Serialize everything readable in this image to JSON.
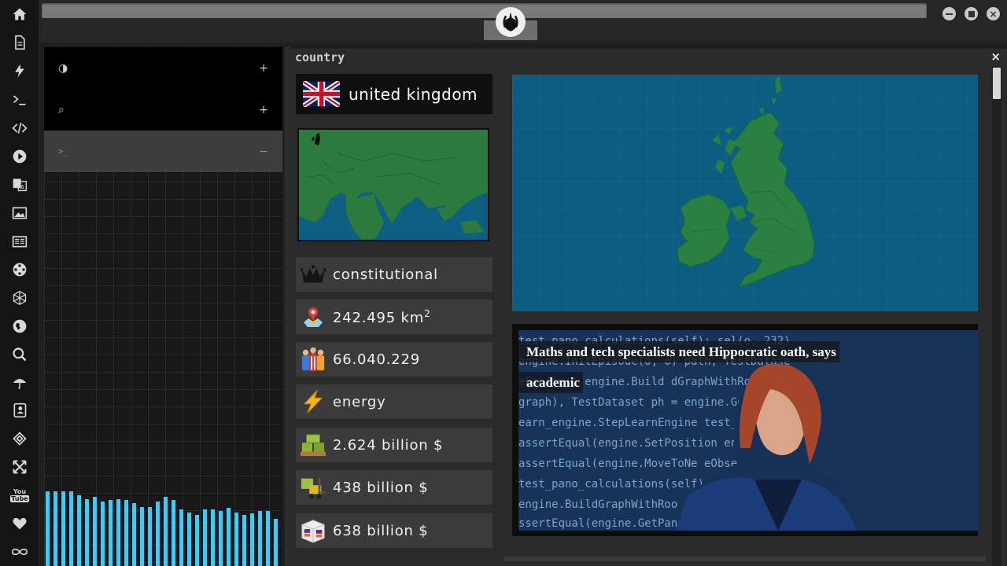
{
  "rail": {
    "icons": [
      "home-icon",
      "document-icon",
      "lightning-icon",
      "terminal-icon",
      "code-icon",
      "play-icon",
      "translate-icon",
      "image-icon",
      "newspaper-icon",
      "film-reel-icon",
      "hexagon-icon",
      "globe-icon",
      "search-icon",
      "umbrella-icon",
      "contacts-icon",
      "tag-icon",
      "expand-icon",
      "youtube-icon",
      "heart-icon",
      "infinity-icon"
    ],
    "youtube_top": "You",
    "youtube_bottom": "Tube"
  },
  "left_panel": {
    "rows": [
      {
        "icon": "◑",
        "action": "+"
      },
      {
        "icon": "⌕",
        "action": "+"
      },
      {
        "icon": ">_",
        "action": "−"
      }
    ],
    "bar_levels": [
      0.95,
      0.95,
      0.95,
      0.95,
      0.9,
      0.85,
      0.88,
      0.82,
      0.84,
      0.85,
      0.84,
      0.8,
      0.75,
      0.75,
      0.82,
      0.88,
      0.84,
      0.72,
      0.68,
      0.65,
      0.72,
      0.72,
      0.7,
      0.74,
      0.68,
      0.65,
      0.67,
      0.7,
      0.7,
      0.6
    ],
    "bar_color": "#4cc6ef"
  },
  "main": {
    "title": "country",
    "close": "×",
    "country_name": "united kingdom",
    "info": [
      {
        "icon": "crown-icon",
        "text": "constitutional",
        "sup": ""
      },
      {
        "icon": "map-pin-icon",
        "text": "242.495 km",
        "sup": "2"
      },
      {
        "icon": "population-icon",
        "text": "66.040.229",
        "sup": ""
      },
      {
        "icon": "energy-icon",
        "text": "energy",
        "sup": ""
      },
      {
        "icon": "pallet-icon",
        "text": "2.624 billion $",
        "sup": ""
      },
      {
        "icon": "forklift-icon",
        "text": "438 billion $",
        "sup": ""
      },
      {
        "icon": "box-icon",
        "text": "638 billion $",
        "sup": ""
      }
    ],
    "news": {
      "headline": "Maths and tech specialists need Hippocratic oath, says academic"
    }
  }
}
